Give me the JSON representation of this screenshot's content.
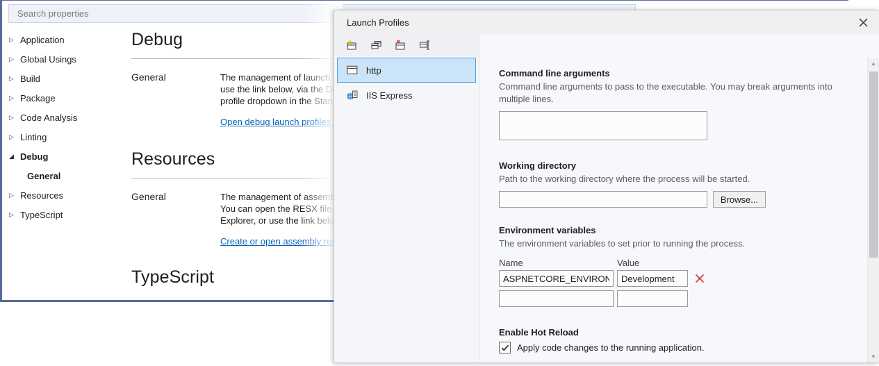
{
  "properties_window": {
    "search": {
      "placeholder": "Search properties",
      "value": ""
    },
    "tree": [
      {
        "label": "Application",
        "arrow": "▷",
        "state": "collapsed",
        "level": 0
      },
      {
        "label": "Global Usings",
        "arrow": "▷",
        "state": "collapsed",
        "level": 0
      },
      {
        "label": "Build",
        "arrow": "▷",
        "state": "collapsed",
        "level": 0
      },
      {
        "label": "Package",
        "arrow": "▷",
        "state": "collapsed",
        "level": 0
      },
      {
        "label": "Code Analysis",
        "arrow": "▷",
        "state": "collapsed",
        "level": 0
      },
      {
        "label": "Linting",
        "arrow": "▷",
        "state": "collapsed",
        "level": 0
      },
      {
        "label": "Debug",
        "arrow": "◢",
        "state": "expanded",
        "level": 0
      },
      {
        "label": "General",
        "arrow": "",
        "state": "child",
        "level": 1
      },
      {
        "label": "Resources",
        "arrow": "▷",
        "state": "collapsed",
        "level": 0
      },
      {
        "label": "TypeScript",
        "arrow": "▷",
        "state": "collapsed",
        "level": 0
      }
    ],
    "sections": [
      {
        "title": "Debug",
        "subtitle": "General",
        "body": "The management of launch profiles has moved. Please use the link below, via the Debug menu or the launch profile dropdown in the Standard tool bar.",
        "link": "Open debug launch profiles UI"
      },
      {
        "title": "Resources",
        "subtitle": "General",
        "body": "The management of assembly resource files has moved. You can open the RESX file directly from Solution Explorer, or use the link below.",
        "link": "Create or open assembly resources"
      },
      {
        "title": "TypeScript"
      }
    ]
  },
  "dialog": {
    "title": "Launch Profiles",
    "close_glyph": "✕",
    "toolbar": [
      {
        "name": "new-profile",
        "tooltip": "Create a new profile"
      },
      {
        "name": "duplicate-profile",
        "tooltip": "Duplicate the selected profile"
      },
      {
        "name": "delete-profile",
        "tooltip": "Delete the selected profile"
      },
      {
        "name": "rename-profile",
        "tooltip": "Rename the selected profile"
      }
    ],
    "profiles": [
      {
        "label": "http",
        "icon": "browser-window-icon",
        "selected": true
      },
      {
        "label": "IIS Express",
        "icon": "iis-globe-icon",
        "selected": false
      }
    ],
    "settings": {
      "command_line_arguments": {
        "label": "Command line arguments",
        "description": "Command line arguments to pass to the executable. You may break arguments into multiple lines.",
        "value": ""
      },
      "working_directory": {
        "label": "Working directory",
        "description": "Path to the working directory where the process will be started.",
        "value": "",
        "browse_label": "Browse..."
      },
      "environment_variables": {
        "label": "Environment variables",
        "description": "The environment variables to set prior to running the process.",
        "columns": [
          "Name",
          "Value"
        ],
        "rows": [
          {
            "name": "ASPNETCORE_ENVIRONMENT",
            "value": "Development",
            "deletable": true
          },
          {
            "name": "",
            "value": "",
            "deletable": false
          }
        ],
        "delete_glyph": "✕"
      },
      "hot_reload": {
        "label": "Enable Hot Reload",
        "checkbox_label": "Apply code changes to the running application.",
        "checked": true,
        "check_glyph": "✔"
      }
    },
    "scrollbar": {
      "up_glyph": "▲",
      "down_glyph": "▼"
    }
  },
  "colors": {
    "accent_selection": "#cce4f7",
    "accent_border": "#4aa0de",
    "link": "#0b61b8",
    "delete_red": "#d9373e",
    "window_border": "#5b6a9e"
  }
}
